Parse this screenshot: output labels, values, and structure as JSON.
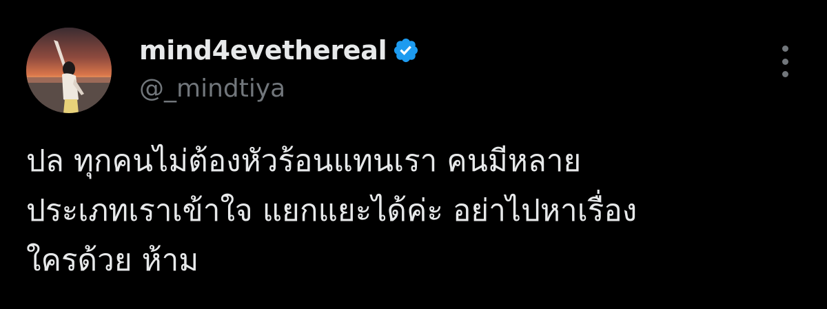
{
  "tweet": {
    "display_name": "mind4evethereal",
    "handle": "@_mindtiya",
    "verified": true,
    "text_lines": [
      "ปล ทุกคนไม่ต้องหัวร้อนแทนเรา คนมีหลาย",
      "ประเภทเราเข้าใจ แยกแยะได้ค่ะ อย่าไปหาเรื่อง",
      "ใครด้วย ห้าม"
    ]
  },
  "icons": {
    "verified": "verified-badge-icon",
    "more": "more-options-icon"
  },
  "colors": {
    "background": "#000000",
    "primary_text": "#e7e9ea",
    "secondary_text": "#71767b",
    "verified_blue": "#1d9bf0"
  }
}
